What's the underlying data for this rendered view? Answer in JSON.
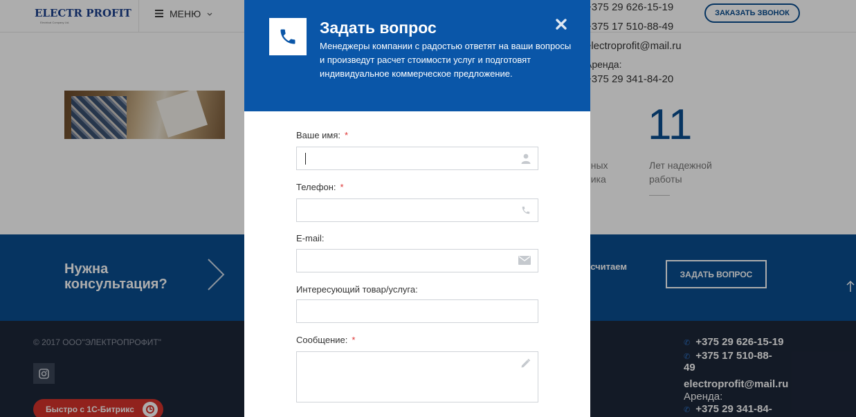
{
  "header": {
    "logo_text": "ELECTR PROFIT",
    "logo_subtext": "Electrical Company Ltd.",
    "menu_label": "МЕНЮ",
    "phone1": "+375 29 626-15-19",
    "phone2": "+375 17 510-88-49",
    "email": "electroprofit@mail.ru",
    "rent_label": "Аренда:",
    "phone3": "+375 29 341-84-20",
    "call_button": "ЗАКАЗАТЬ ЗВОНОК"
  },
  "stats": {
    "years_number": "11",
    "years_line1": "Лет надежной",
    "years_line2": "работы",
    "other_line1": "нных",
    "other_line2": "ника"
  },
  "band": {
    "title_line1": "Нужна",
    "title_line2": "консультация?",
    "partial_text": "ссчитаем",
    "ask_button": "ЗАДАТЬ ВОПРОС"
  },
  "footer": {
    "copyright": "© 2017 ООО\"ЭЛЕКТРОПРОФИТ\"",
    "bitrix_label": "Быстро с 1С-Битрикс",
    "phone1": "+375 29 626-15-19",
    "phone2_a": "+375 17 510-88-",
    "phone2_b": "49",
    "email": "electroprofit@mail.ru",
    "rent_label": "Аренда:",
    "phone3": "+375 29 341-84-"
  },
  "modal": {
    "title": "Задать вопрос",
    "description": "Менеджеры компании с радостью ответят на ваши вопросы и произведут расчет стоимости услуг и подготовят индивидуальное коммерческое предложение.",
    "fields": {
      "name_label": "Ваше имя:",
      "phone_label": "Телефон:",
      "email_label": "E-mail:",
      "product_label": "Интересующий товар/услуга:",
      "message_label": "Сообщение:",
      "required_mark": "*"
    }
  },
  "colors": {
    "brand_blue": "#0a4d8f",
    "modal_header_blue": "#0a56a8",
    "footer_dark": "#1d2739",
    "bitrix_red": "#d6332c"
  }
}
